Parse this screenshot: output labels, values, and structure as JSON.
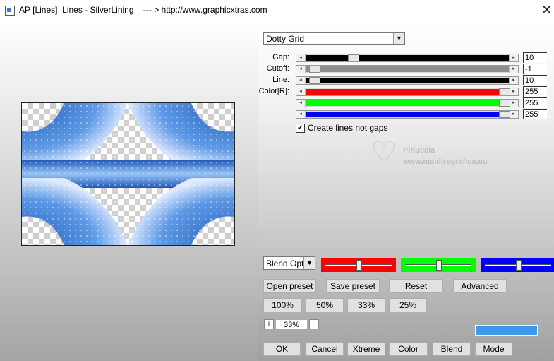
{
  "window": {
    "title": "AP [Lines]  Lines - SilverLining    --- > http://www.graphicxtras.com"
  },
  "preset_dropdown": {
    "value": "Dotty Grid"
  },
  "sliders": [
    {
      "label": "Gap:",
      "value": "10",
      "level": 0.22,
      "color": "#000000"
    },
    {
      "label": "Cutoff:",
      "value": "-1",
      "level": 0.02,
      "color": "#8c8c8c"
    },
    {
      "label": "Line:",
      "value": "10",
      "level": 0.02,
      "color": "#000000"
    },
    {
      "label": "Color[R]:",
      "value": "255",
      "level": 1.0,
      "color": "#ff0000"
    },
    {
      "label": "",
      "value": "255",
      "level": 1.0,
      "color": "#00ff00"
    },
    {
      "label": "",
      "value": "255",
      "level": 1.0,
      "color": "#0000ff"
    }
  ],
  "checkbox": {
    "label": "Create lines not gaps",
    "checked": true
  },
  "watermark": {
    "name": "Pinuccia",
    "url": "www.maidiregrafica.eu"
  },
  "blend_dropdown": {
    "value": "Blend Opti"
  },
  "channel_boxes": [
    {
      "color": "#ff0000",
      "level": 0.5
    },
    {
      "color": "#00ff00",
      "level": 0.5
    },
    {
      "color": "#0000ff",
      "level": 0.5
    }
  ],
  "buttons": {
    "open_preset": "Open preset",
    "save_preset": "Save preset",
    "reset": "Reset",
    "advanced": "Advanced",
    "zoom_100": "100%",
    "zoom_50": "50%",
    "zoom_33": "33%",
    "zoom_25": "25%",
    "ok": "OK",
    "cancel": "Cancel",
    "xtreme": "Xtreme",
    "color": "Color",
    "blend": "Blend",
    "mode": "Mode"
  },
  "zoom": {
    "plus": "+",
    "minus": "−",
    "value": "33%"
  },
  "preview_colors": {
    "deep": "#1f5fc2",
    "light": "#cfe3ff",
    "mid": "#4c8ce2"
  },
  "swatch_color": "#3b99f2"
}
